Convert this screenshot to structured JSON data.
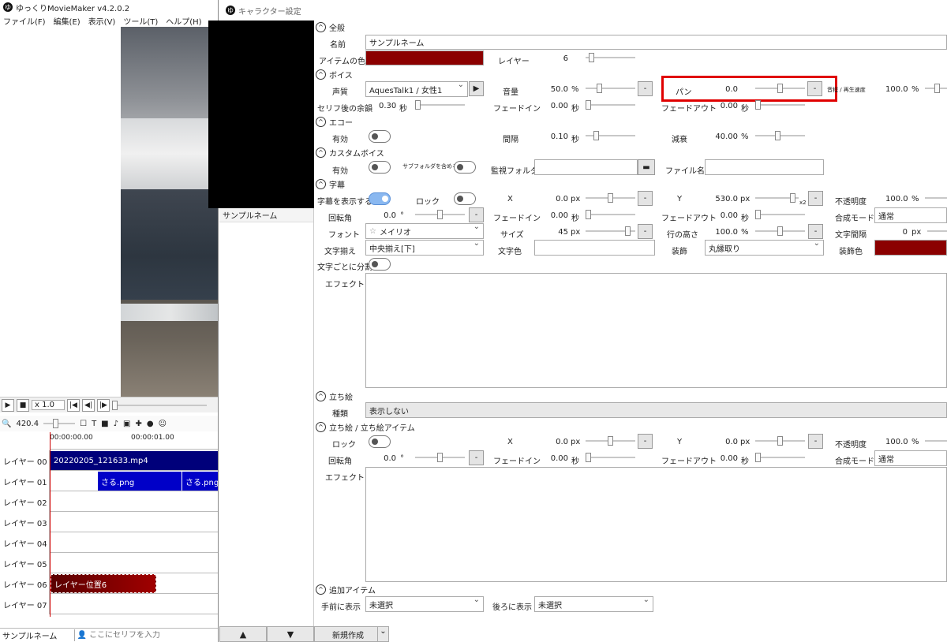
{
  "main": {
    "title": "ゆっくりMovieMaker v4.2.0.2",
    "app_icon": "ゆ",
    "menu": [
      "ファイル(F)",
      "編集(E)",
      "表示(V)",
      "ツール(T)",
      "ヘルプ(H)"
    ],
    "speed": "x 1.0",
    "zoom": "420.4",
    "ruler": [
      "00:00:00.00",
      "00:00:01.00"
    ],
    "layers": [
      "レイヤー 00",
      "レイヤー 01",
      "レイヤー 02",
      "レイヤー 03",
      "レイヤー 04",
      "レイヤー 05",
      "レイヤー 06",
      "レイヤー 07"
    ],
    "clips": {
      "video": "20220205_121633.mp4",
      "png1": "さる.png",
      "png2": "さる.png",
      "layer6": "レイヤー位置6"
    },
    "bottom": {
      "character": "サンプルネーム",
      "placeholder": "ここにセリフを入力"
    }
  },
  "dialog": {
    "title": "キャラクター設定",
    "char_list": [
      "サンプルネーム"
    ],
    "new_button": "新規作成",
    "sections": {
      "general": "全般",
      "voice": "ボイス",
      "echo": "エコー",
      "custom_voice": "カスタムボイス",
      "subtitle": "字幕",
      "tachie": "立ち絵",
      "tachie_item": "立ち絵 / 立ち絵アイテム",
      "additional": "追加アイテム"
    },
    "general": {
      "name_label": "名前",
      "name_value": "サンプルネーム",
      "color_label": "アイテムの色",
      "item_color": "#8b0000",
      "layer_label": "レイヤー",
      "layer_value": "6"
    },
    "voice": {
      "voice_label": "声質",
      "voice_value": "AquesTalk1 / 女性1",
      "volume_label": "音量",
      "volume_value": "50.0",
      "volume_unit": "%",
      "pan_label": "パン",
      "pan_value": "0.0",
      "speed_label": "音程 / 再生速度",
      "speed_value": "100.0",
      "speed_unit": "%",
      "margin_label": "セリフ後の余韻",
      "margin_value": "0.30",
      "margin_unit": "秒",
      "fadein_label": "フェードイン",
      "fadein_value": "0.00",
      "fadein_unit": "秒",
      "fadeout_label": "フェードアウト",
      "fadeout_value": "0.00",
      "fadeout_unit": "秒"
    },
    "echo": {
      "enabled_label": "有効",
      "interval_label": "間隔",
      "interval_value": "0.10",
      "interval_unit": "秒",
      "decay_label": "減衰",
      "decay_value": "40.00",
      "decay_unit": "%"
    },
    "custom_voice": {
      "enabled_label": "有効",
      "subfolder_label": "サブフォルダを含める",
      "folder_label": "監視フォルダ",
      "file_label": "ファイル名"
    },
    "subtitle": {
      "show_label": "字幕を表示する",
      "lock_label": "ロック",
      "x_label": "X",
      "x_value": "0.0",
      "x_unit": "px",
      "y_label": "Y",
      "y_value": "530.0",
      "y_unit": "px",
      "x2": "x2",
      "opacity_label": "不透明度",
      "opacity_value": "100.0",
      "opacity_unit": "%",
      "rotate_label": "回転角",
      "rotate_value": "0.0",
      "rotate_unit": "°",
      "fadein_label": "フェードイン",
      "fadein_value": "0.00",
      "fadein_unit": "秒",
      "fadeout_label": "フェードアウト",
      "fadeout_value": "0.00",
      "fadeout_unit": "秒",
      "blend_label": "合成モード",
      "blend_value": "通常",
      "font_label": "フォント",
      "font_value": "メイリオ",
      "size_label": "サイズ",
      "size_value": "45",
      "size_unit": "px",
      "lineheight_label": "行の高さ",
      "lineheight_value": "100.0",
      "lineheight_unit": "%",
      "spacing_label": "文字間隔",
      "spacing_value": "0",
      "spacing_unit": "px",
      "align_label": "文字揃え",
      "align_value": "中央揃え[下]",
      "color_label": "文字色",
      "deco_label": "装飾",
      "deco_value": "丸縁取り",
      "decocolor_label": "装飾色",
      "deco_color": "#8b0000",
      "split_label": "文字ごとに分割",
      "effect_label": "エフェクト"
    },
    "tachie": {
      "type_label": "種類",
      "type_value": "表示しない"
    },
    "tachie_item": {
      "lock_label": "ロック",
      "x_label": "X",
      "x_value": "0.0",
      "x_unit": "px",
      "y_label": "Y",
      "y_value": "0.0",
      "y_unit": "px",
      "opacity_label": "不透明度",
      "opacity_value": "100.0",
      "opacity_unit": "%",
      "rotate_label": "回転角",
      "rotate_value": "0.0",
      "rotate_unit": "°",
      "fadein_label": "フェードイン",
      "fadein_value": "0.00",
      "fadein_unit": "秒",
      "fadeout_label": "フェードアウト",
      "fadeout_value": "0.00",
      "fadeout_unit": "秒",
      "blend_label": "合成モード",
      "blend_value": "通常",
      "effect_label": "エフェクト"
    },
    "additional": {
      "front_label": "手前に表示",
      "front_value": "未選択",
      "back_label": "後ろに表示",
      "back_value": "未選択"
    }
  }
}
